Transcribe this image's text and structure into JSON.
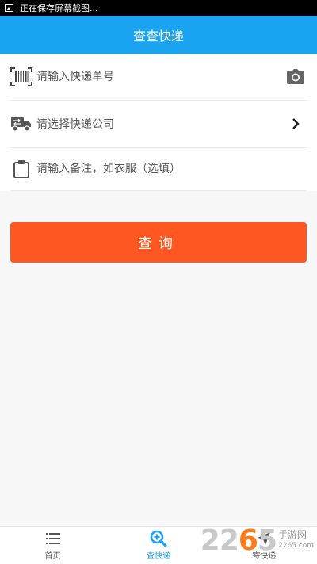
{
  "status_bar": {
    "notification": "正在保存屏幕截图..."
  },
  "header": {
    "title": "查查快递"
  },
  "form": {
    "tracking_number": {
      "placeholder": "请输入快递单号"
    },
    "courier": {
      "label": "请选择快递公司"
    },
    "note": {
      "placeholder": "请输入备注，如衣服（选填）"
    }
  },
  "query_button": {
    "label": "查询"
  },
  "tabbar": {
    "tabs": [
      {
        "label": "首页",
        "icon": "list-icon"
      },
      {
        "label": "查快递",
        "icon": "search-zoom-icon"
      },
      {
        "label": "寄快递",
        "icon": "send-icon"
      }
    ],
    "active_index": 1
  },
  "watermark": {
    "brand_prefix": "22",
    "brand_accent": "6",
    "brand_suffix": "5",
    "tagline": "手游网",
    "url": "2265.com"
  },
  "colors": {
    "header_blue": "#1aa3f0",
    "button_orange": "#ff5722"
  }
}
